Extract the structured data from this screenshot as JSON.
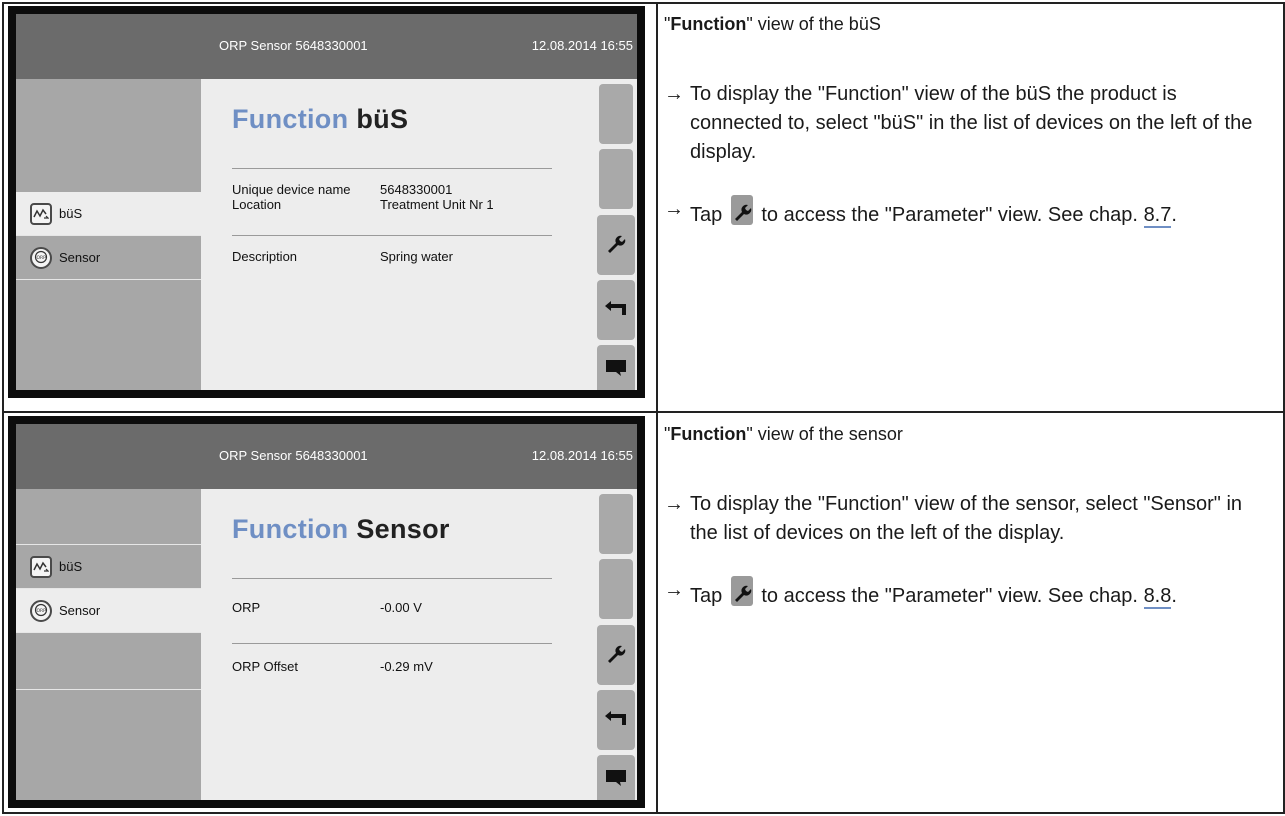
{
  "sections": [
    {
      "screen": {
        "title": "ORP Sensor 5648330001",
        "datetime": "12.08.2014 16:55",
        "heading_keyword": "Function",
        "heading_device": "büS",
        "sidebar": [
          {
            "label": "büS",
            "icon": "bus-icon",
            "selected": true
          },
          {
            "label": "Sensor",
            "icon": "orp-sensor-icon",
            "selected": false
          }
        ],
        "rows": [
          {
            "key": "Unique device name",
            "value": "5648330001"
          },
          {
            "key": "Location",
            "value": "Treatment Unit Nr 1"
          },
          {
            "key": "Description",
            "value": "Spring water"
          }
        ]
      },
      "desc": {
        "title_prefix": "\"",
        "title_bold": "Function",
        "title_rest": "\" view of the büS",
        "step1": "To display the \"Function\" view of the büS the product is connected to, select \"büS\" in the list of devices on the left of the display.",
        "step2_before": "Tap",
        "step2_after": "to access the \"Parameter\" view. See chap.",
        "chap": "8.7",
        "period": "."
      }
    },
    {
      "screen": {
        "title": "ORP Sensor 5648330001",
        "datetime": "12.08.2014 16:55",
        "heading_keyword": "Function",
        "heading_device": "Sensor",
        "sidebar": [
          {
            "label": "büS",
            "icon": "bus-icon",
            "selected": false
          },
          {
            "label": "Sensor",
            "icon": "orp-sensor-icon",
            "selected": true
          }
        ],
        "rows": [
          {
            "key": "ORP",
            "value": "-0.00 V"
          },
          {
            "key": "ORP Offset",
            "value": "-0.29 mV"
          }
        ]
      },
      "desc": {
        "title_prefix": "\"",
        "title_bold": "Function",
        "title_rest": "\" view of the sensor",
        "step1": "To display the \"Function\" view of the sensor, select \"Sensor\" in the list of devices on the left of the display.",
        "step2_before": "Tap",
        "step2_after": "to access the \"Parameter\" view. See chap.",
        "chap": "8.8",
        "period": "."
      }
    }
  ],
  "icons": {
    "arrow": "→",
    "wrench": "wrench-icon",
    "back": "back-icon",
    "message": "message-icon"
  },
  "colors": {
    "accent_heading": "#6f8fc4",
    "topbar": "#6b6b6b",
    "link_underline": "#6f8fc4"
  }
}
